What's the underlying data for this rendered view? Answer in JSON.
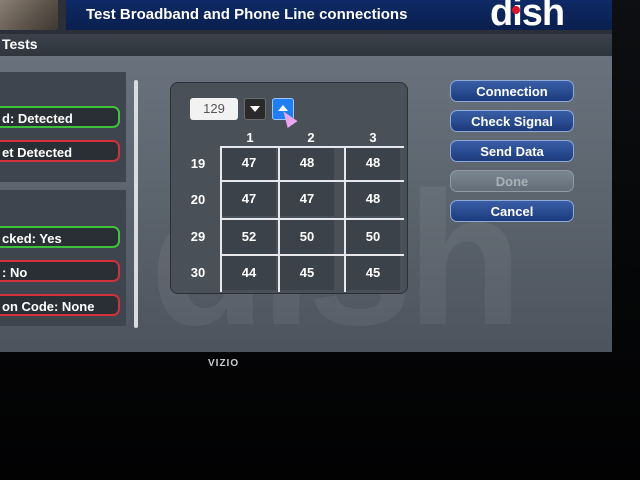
{
  "header": {
    "title": "Test Broadband and Phone Line connections",
    "brand": "dish"
  },
  "subtitle": "Tests",
  "left_panel": {
    "top_items": [
      {
        "label": "d: Detected",
        "status": "green"
      },
      {
        "label": "et Detected",
        "status": "red"
      }
    ],
    "bottom_items": [
      {
        "label": "cked: Yes",
        "status": "green"
      },
      {
        "label": ": No",
        "status": "red"
      },
      {
        "label": "on Code: None",
        "status": "red"
      }
    ]
  },
  "grid": {
    "channel_value": "129",
    "columns": [
      "1",
      "2",
      "3"
    ],
    "rows": [
      {
        "label": "19",
        "values": [
          "47",
          "48",
          "48"
        ]
      },
      {
        "label": "20",
        "values": [
          "47",
          "47",
          "48"
        ]
      },
      {
        "label": "29",
        "values": [
          "52",
          "50",
          "50"
        ]
      },
      {
        "label": "30",
        "values": [
          "44",
          "45",
          "45"
        ]
      }
    ]
  },
  "actions": {
    "connection": "Connection",
    "check_signal": "Check Signal",
    "send_data": "Send Data",
    "done": "Done",
    "cancel": "Cancel"
  },
  "tv_brand": "VIZIO",
  "colors": {
    "ok": "#3ec23a",
    "fail": "#d2303a",
    "accent": "#1f7ff0",
    "header": "#0e2a66"
  }
}
